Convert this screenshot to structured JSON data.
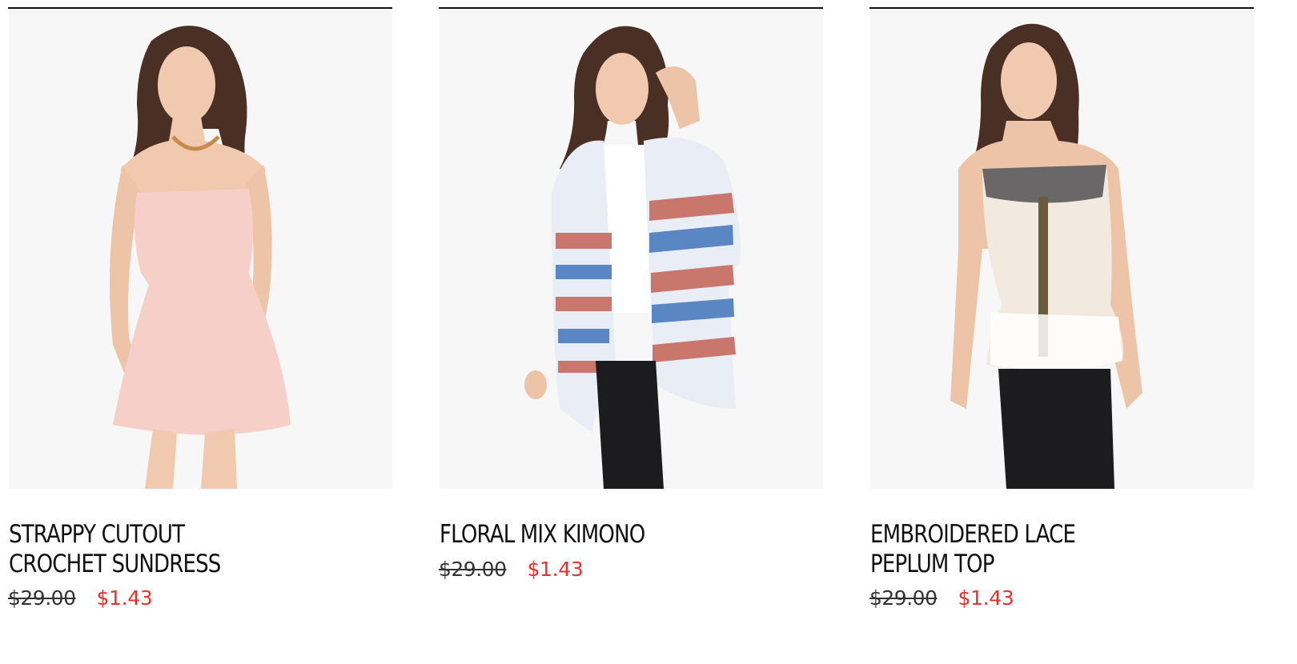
{
  "colors": {
    "sale_price": "#e8312f",
    "text": "#111111",
    "rule": "#111111",
    "photo_bg": "#f7f7f7"
  },
  "products": [
    {
      "title_lines": [
        "STRAPPY CUTOUT",
        "CROCHET SUNDRESS"
      ],
      "price_original": "$29.00",
      "price_sale": "$1.43",
      "image_icon": "model-pink-sundress-image"
    },
    {
      "title_lines": [
        "FLORAL MIX KIMONO"
      ],
      "price_original": "$29.00",
      "price_sale": "$1.43",
      "image_icon": "model-floral-kimono-image"
    },
    {
      "title_lines": [
        "EMBROIDERED LACE",
        "PEPLUM TOP"
      ],
      "price_original": "$29.00",
      "price_sale": "$1.43",
      "image_icon": "model-embroidered-peplum-top-image"
    }
  ]
}
